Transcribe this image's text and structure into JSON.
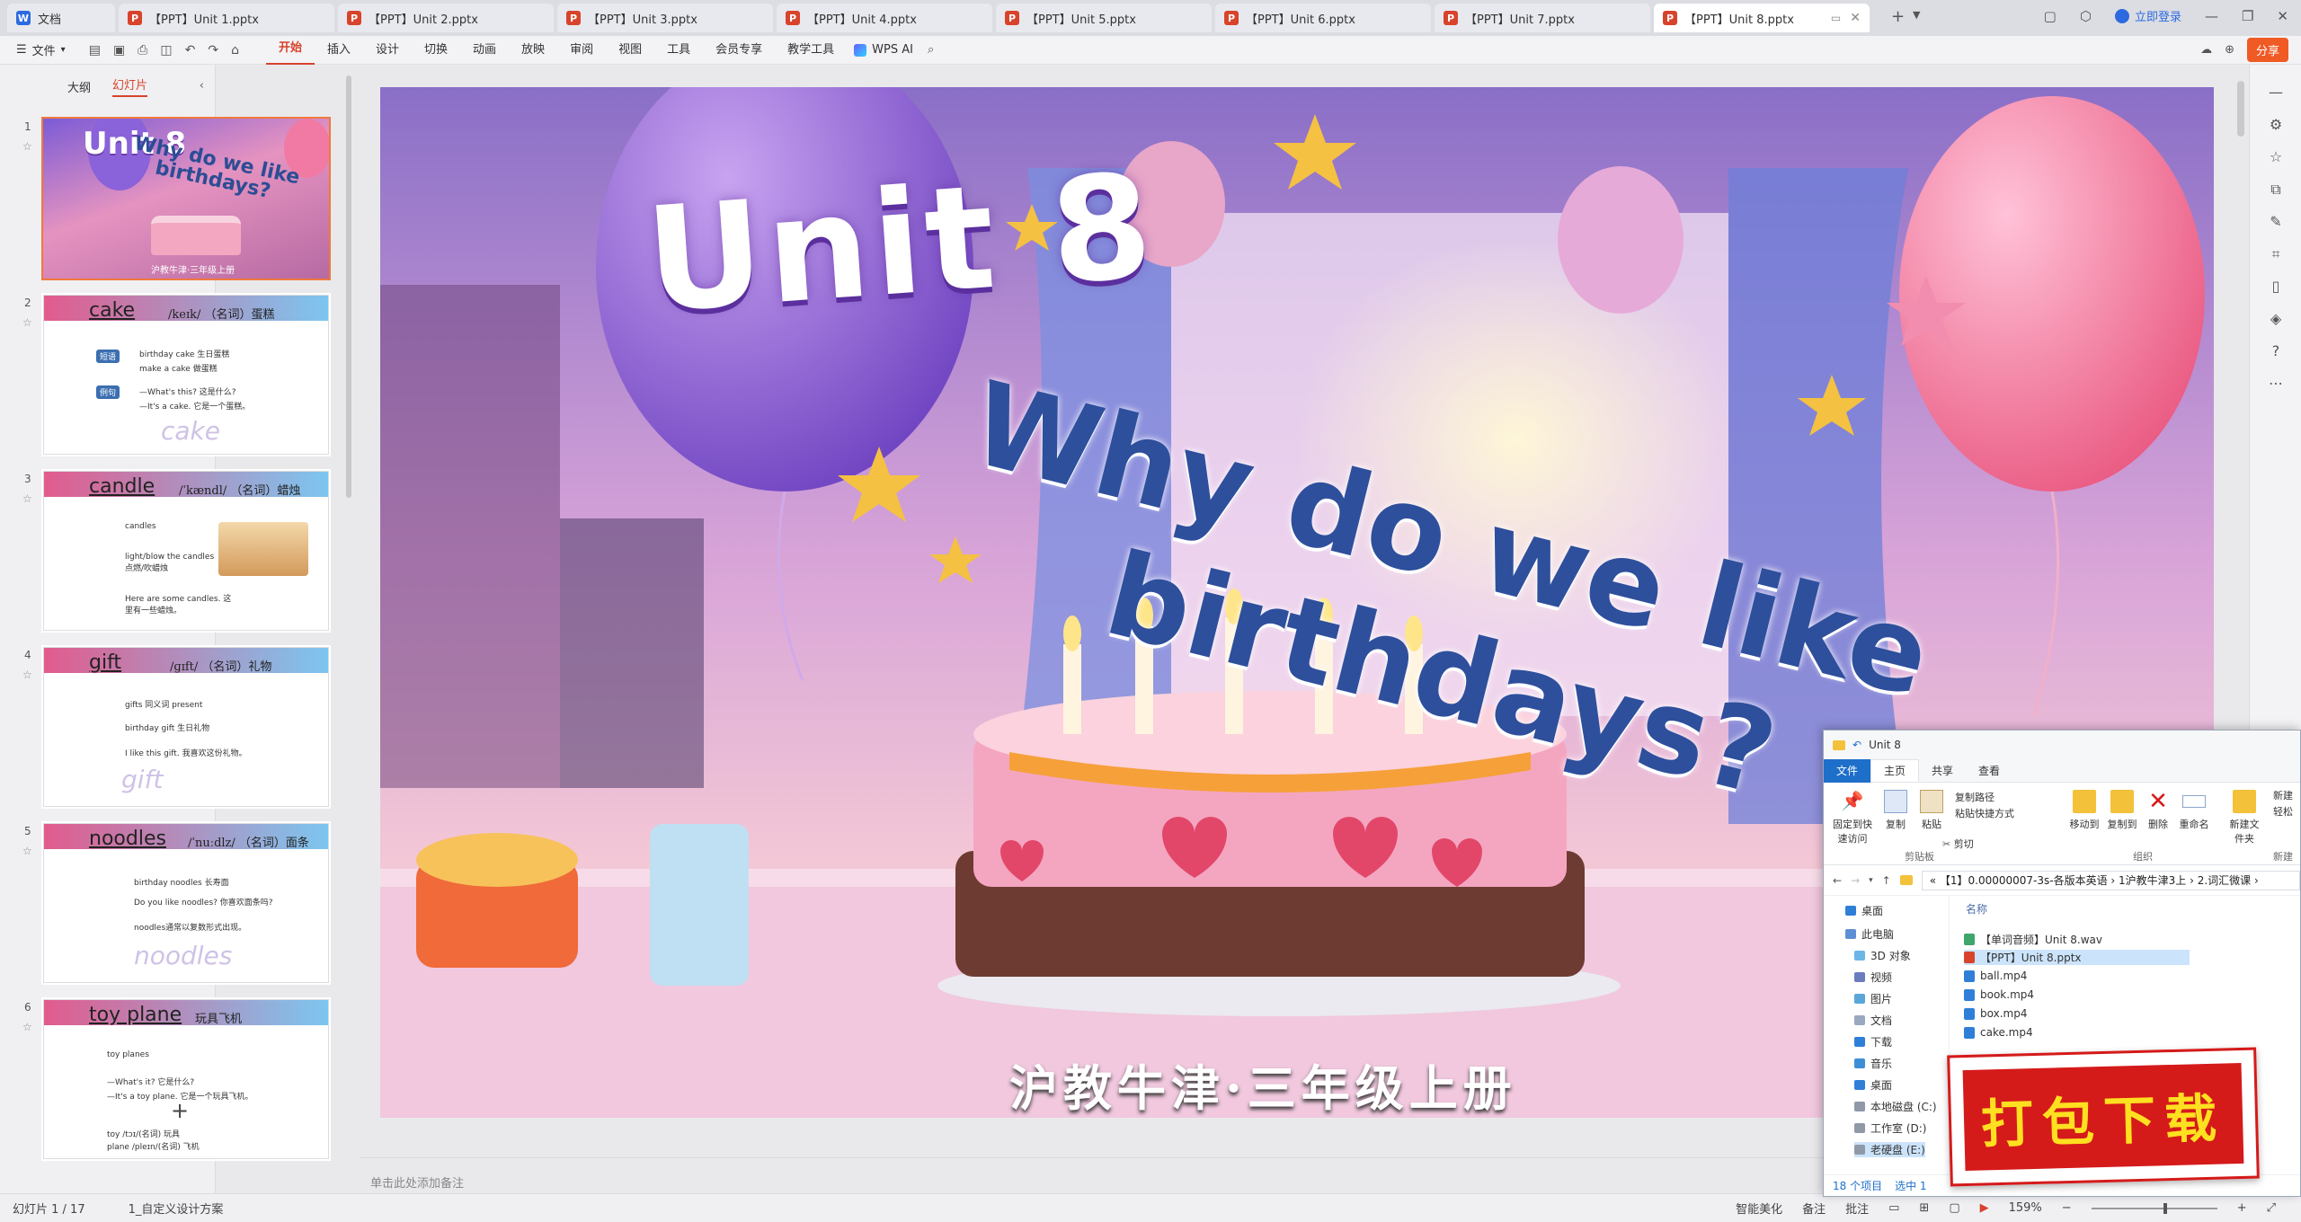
{
  "tabs": [
    {
      "label": "文档",
      "icon": "doc-icon",
      "active": false
    },
    {
      "label": "【PPT】Unit 1.pptx",
      "icon": "ppt-icon",
      "active": false
    },
    {
      "label": "【PPT】Unit 2.pptx",
      "icon": "ppt-icon",
      "active": false
    },
    {
      "label": "【PPT】Unit 3.pptx",
      "icon": "ppt-icon",
      "active": false
    },
    {
      "label": "【PPT】Unit 4.pptx",
      "icon": "ppt-icon",
      "active": false
    },
    {
      "label": "【PPT】Unit 5.pptx",
      "icon": "ppt-icon",
      "active": false
    },
    {
      "label": "【PPT】Unit 6.pptx",
      "icon": "ppt-icon",
      "active": false
    },
    {
      "label": "【PPT】Unit 7.pptx",
      "icon": "ppt-icon",
      "active": false
    },
    {
      "label": "【PPT】Unit 8.pptx",
      "icon": "ppt-icon",
      "active": true
    }
  ],
  "titlebar": {
    "login": "立即登录",
    "share": "分享"
  },
  "menubar": {
    "file": "文件",
    "items": [
      "开始",
      "插入",
      "设计",
      "切换",
      "动画",
      "放映",
      "审阅",
      "视图",
      "工具",
      "会员专享",
      "教学工具"
    ],
    "active": "开始",
    "wps_ai": "WPS AI"
  },
  "leftpane": {
    "tab_outline": "大纲",
    "tab_slides": "幻灯片",
    "active": "幻灯片"
  },
  "thumbs": [
    {
      "num": "1",
      "unit": "Unit 8",
      "title": "Why do we like birthdays?",
      "sub": "沪教牛津·三年级上册"
    },
    {
      "num": "2",
      "word": "cake",
      "phon": "/keɪk/ （名词）蛋糕",
      "lines": [
        "birthday cake  生日蛋糕",
        "make a cake  做蛋糕",
        "—What's this?  这是什么?",
        "—It's a cake.  它是一个蛋糕。"
      ],
      "mem": "cake"
    },
    {
      "num": "3",
      "word": "candle",
      "phon": "/ˈkændl/ （名词）蜡烛",
      "lines": [
        "candles",
        "light/blow the candles  点燃/吹蜡烛",
        "Here are some candles.  这里有一些蜡烛。"
      ]
    },
    {
      "num": "4",
      "word": "gift",
      "phon": "/ɡɪft/ （名词）礼物",
      "lines": [
        "gifts   同义词   present",
        "birthday gift  生日礼物",
        "I like this gift.  我喜欢这份礼物。"
      ],
      "mem": "gift"
    },
    {
      "num": "5",
      "word": "noodles",
      "phon": "/ˈnuːdlz/ （名词）面条",
      "lines": [
        "birthday noodles  长寿面",
        "Do you like noodles?  你喜欢面条吗?",
        "noodles通常以复数形式出现。"
      ],
      "mem": "noodles"
    },
    {
      "num": "6",
      "word": "toy plane",
      "phon": "玩具飞机",
      "lines": [
        "toy planes",
        "—What's it?  它是什么?",
        "—It's a toy plane.  它是一个玩具飞机。",
        "toy /tɔɪ/(名词) 玩具",
        "plane /pleɪn/(名词) 飞机"
      ]
    }
  ],
  "slide": {
    "unit": "Unit 8",
    "title_line1": "Why do we like",
    "title_line2": "birthdays?",
    "subtitle": "沪教牛津·三年级上册"
  },
  "notes_placeholder": "单击此处添加备注",
  "statusbar": {
    "slide_count": "幻灯片 1 / 17",
    "theme": "1_自定义设计方案",
    "smart": "智能美化",
    "notes": "备注",
    "comment": "批注",
    "zoom": "159%"
  },
  "explorer": {
    "title": "Unit 8",
    "tabs": [
      "文件",
      "主页",
      "共享",
      "查看"
    ],
    "ribbon": {
      "pin": "固定到快速访问",
      "copy": "复制",
      "paste": "粘贴",
      "copy_path": "复制路径",
      "paste_shortcut": "粘贴快捷方式",
      "cut": "剪切",
      "clipboard": "剪贴板",
      "move_to": "移动到",
      "copy_to": "复制到",
      "delete": "删除",
      "rename": "重命名",
      "organize": "组织",
      "new_folder": "新建文件夹",
      "new": "新建",
      "new_item": "新建",
      "easy_access": "轻松"
    },
    "path": "« 【1】0.00000007-3s-各版本英语 › 1沪教牛津3上 › 2.词汇微课 ›",
    "tree": [
      "桌面",
      "此电脑",
      "3D 对象",
      "视频",
      "图片",
      "文档",
      "下载",
      "音乐",
      "桌面",
      "本地磁盘 (C:)",
      "工作室 (D:)",
      "老硬盘 (E:)"
    ],
    "list_header": "名称",
    "files": [
      {
        "name": "【单词音频】Unit 8.wav",
        "type": "wav"
      },
      {
        "name": "【PPT】Unit 8.pptx",
        "type": "ppt",
        "selected": true
      },
      {
        "name": "ball.mp4",
        "type": "mp4"
      },
      {
        "name": "book.mp4",
        "type": "mp4"
      },
      {
        "name": "box.mp4",
        "type": "mp4"
      },
      {
        "name": "cake.mp4",
        "type": "mp4"
      }
    ],
    "status_items": "18 个项目",
    "status_selected": "选中 1"
  },
  "download_badge": "打包下载"
}
